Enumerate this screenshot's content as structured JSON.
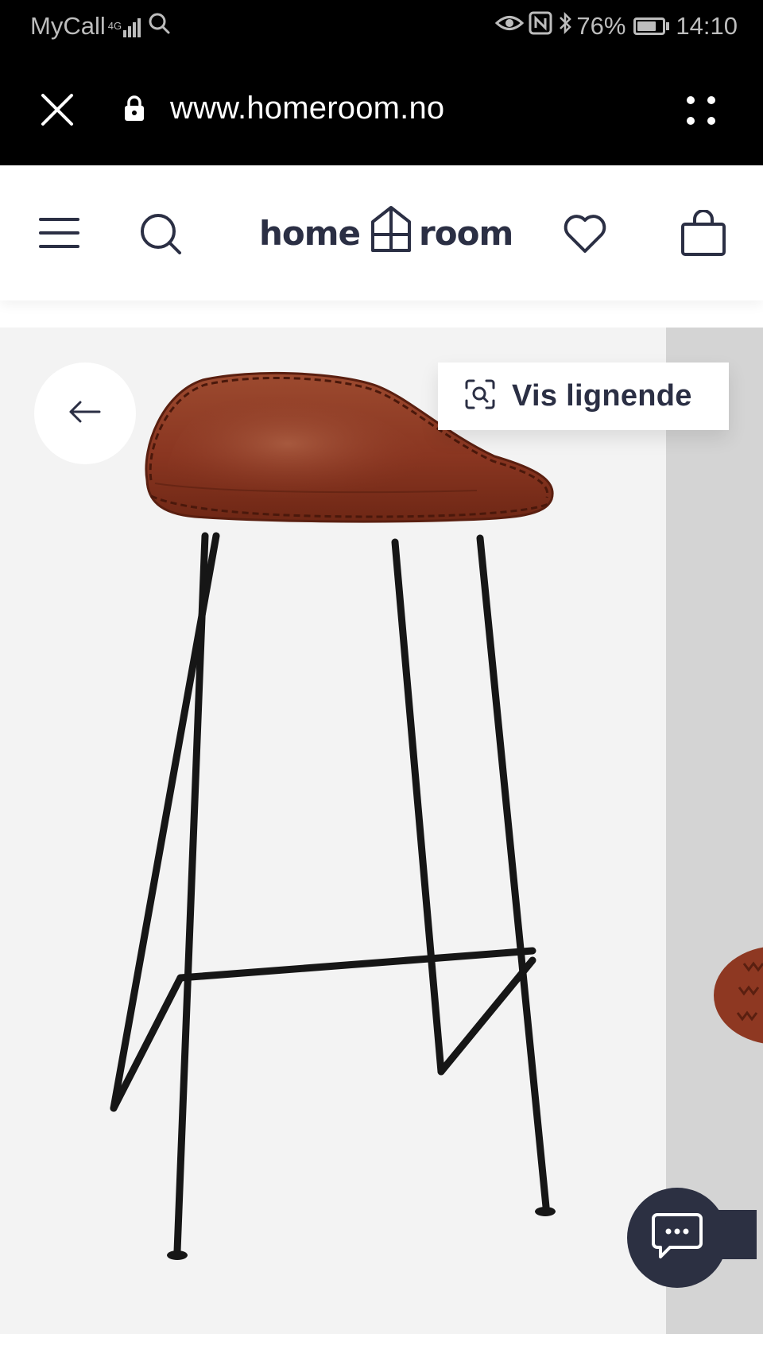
{
  "status_bar": {
    "carrier": "MyCall",
    "network": "4G",
    "battery": "76%",
    "battery_level": 0.76,
    "time": "14:10"
  },
  "browser": {
    "url": "www.homeroom.no"
  },
  "header": {
    "logo_left": "home",
    "logo_right": "room"
  },
  "gallery": {
    "similar_label": "Vis lignende"
  },
  "icons": {
    "close": "close-icon",
    "lock": "lock-icon",
    "more": "more-dots-icon",
    "menu": "hamburger-menu-icon",
    "search": "search-icon",
    "favorite": "heart-icon",
    "cart": "shopping-bag-icon",
    "back": "arrow-left-icon",
    "visual_search": "visual-search-icon",
    "chat": "chat-bubble-icon"
  },
  "colors": {
    "brand_dark": "#2b2f44",
    "chat_bg": "#2c3042",
    "leather": "#8e3822",
    "gallery_bg": "#f3f3f3"
  }
}
